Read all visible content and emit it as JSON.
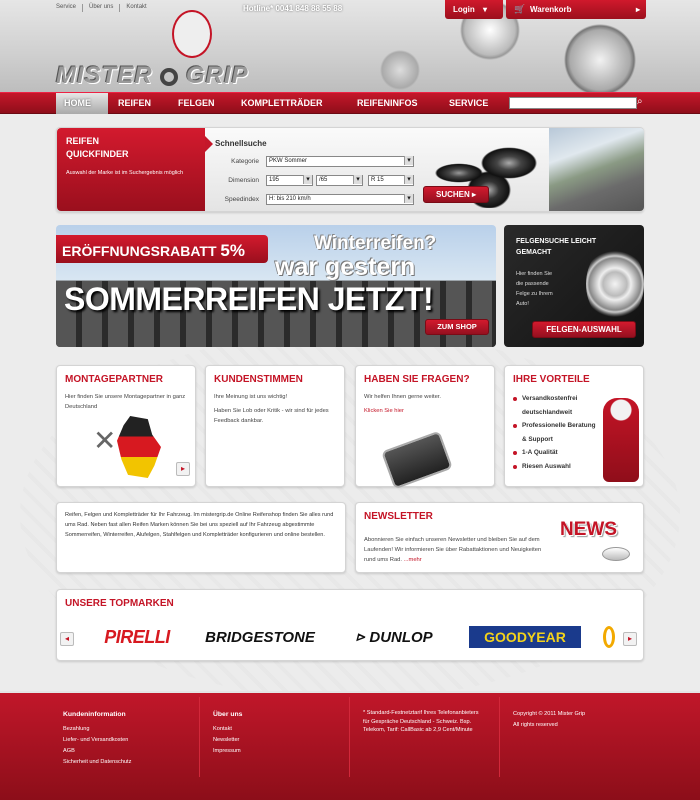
{
  "header": {
    "top_links": [
      "Service",
      "Über uns",
      "Kontakt"
    ],
    "hotline": "Hotline* 0041 848 88 55 88",
    "login": "Login",
    "cart": "Warenkorb",
    "logo_left": "MISTER",
    "logo_right": "GRIP"
  },
  "nav": {
    "items": [
      "HOME",
      "REIFEN",
      "FELGEN",
      "KOMPLETTRÄDER",
      "REIFENINFOS",
      "SERVICE"
    ],
    "search_placeholder": ""
  },
  "quickfinder": {
    "title_line1": "REIFEN",
    "title_line2": "QUICKFINDER",
    "description": "Auswahl der Marke ist im Suchergebnis möglich",
    "heading": "Schnellsuche",
    "label_kategorie": "Kategorie",
    "label_dimension": "Dimension",
    "label_speedindex": "Speedindex",
    "kategorie_value": "PKW Sommer",
    "width_value": "195",
    "ratio_value": "/65",
    "rim_value": "R 15",
    "speed_value": "H: bis 210 km/h",
    "search_button": "SUCHEN"
  },
  "banner": {
    "rabatt": "ERÖFFNUNGSRABATT",
    "rabatt_pct": "5%",
    "line1": "Winterreifen?",
    "line2": "war gestern",
    "line3": "SOMMERREIFEN JETZT!",
    "shop_button": "ZUM SHOP"
  },
  "felgensuche": {
    "title_line1": "FELGENSUCHE LEICHT",
    "title_line2": "GEMACHT",
    "text": [
      "Hier finden Sie",
      "die passende",
      "Felge zu Ihrem",
      "Auto!"
    ],
    "button": "FELGEN-AUSWAHL"
  },
  "cards": {
    "montage": {
      "title": "MONTAGEPARTNER",
      "text": "Hier finden Sie unsere Montagepartner in ganz Deutschland"
    },
    "kunden": {
      "title": "KUNDENSTIMMEN",
      "text1": "Ihre Meinung ist uns wichtig!",
      "text2": "Haben Sie Lob oder Kritik - wir sind für jedes Feedback dankbar."
    },
    "fragen": {
      "title": "HABEN SIE FRAGEN?",
      "text": "Wir helfen Ihnen gerne weiter.",
      "link": "Klicken Sie hier"
    },
    "vorteile": {
      "title": "IHRE VORTEILE",
      "items": [
        "Versandkostenfrei deutschlandweit",
        "Professionelle Beratung & Support",
        "1-A Qualität",
        "Riesen Auswahl"
      ]
    }
  },
  "info_text": "Reifen, Felgen und Kompletträder für Ihr Fahrzeug. Im mistergrip.de Online Reifenshop finden Sie alles rund ums Rad. Neben fast allen Reifen Marken können Sie bei uns speziell auf Ihr Fahrzeug abgestimmte Sommerreifen, Winterreifen, Alufelgen, Stahlfelgen und Kompletträder konfigurieren und online bestellen.",
  "newsletter": {
    "title": "NEWSLETTER",
    "text": "Abonnieren Sie einfach unseren Newsletter und bleiben Sie auf dem Laufenden! Wir informieren Sie über Rabattaktionen und Neuigkeiten rund ums Rad.",
    "more": "...mehr",
    "news_word": "NEWS"
  },
  "brands": {
    "title": "UNSERE TOPMARKEN",
    "list": [
      "PIRELLI",
      "BRIDGESTONE",
      "DUNLOP",
      "GOODYEAR"
    ]
  },
  "footer": {
    "col1": {
      "title": "Kundeninformation",
      "links": [
        "Bezahlung",
        "Liefer- und Versandkosten",
        "AGB",
        "Sicherheit und Datenschutz"
      ]
    },
    "col2": {
      "title": "Über uns",
      "links": [
        "Kontakt",
        "Newsletter",
        "Impressum"
      ]
    },
    "col3": "* Standard-Festnetztarif Ihres Telefonanbieters für Gespräche Deutschland - Schweiz. Bsp. Telekom, Tarif: CallBasic ab 2,9 Cent/Minute",
    "copyright": "Copyright © 2011 Mister Grip",
    "rights": "All rights reserved"
  },
  "colors": {
    "brand_red": "#c41426",
    "dark_red": "#8f0e1a",
    "goodyear_blue": "#1a3a8c",
    "goodyear_yellow": "#f2d21b"
  }
}
